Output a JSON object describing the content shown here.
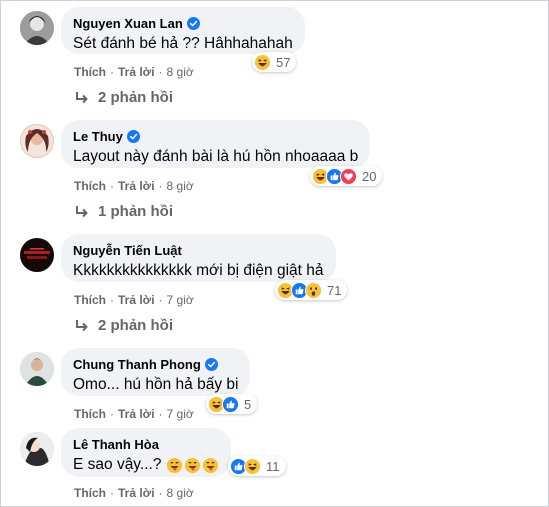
{
  "comments": [
    {
      "name": "Nguyen Xuan Lan",
      "verified": true,
      "text": "Sét đánh bé hả ?? Hâhhahahah",
      "reactions": [
        "haha-icon"
      ],
      "count": "57",
      "like": "Thích",
      "reply": "Trả lời",
      "time": "8 giờ",
      "replies": "2 phản hồi"
    },
    {
      "name": "Le Thuy",
      "verified": true,
      "text": "Layout này đánh bài là hú hồn nhoaaaa b",
      "reactions": [
        "haha-icon",
        "like-icon",
        "love-icon"
      ],
      "count": "20",
      "like": "Thích",
      "reply": "Trả lời",
      "time": "8 giờ",
      "replies": "1 phản hồi"
    },
    {
      "name": "Nguyễn Tiến Luật",
      "verified": false,
      "text": "Kkkkkkkkkkkkkkk mới bị điện giật hả",
      "reactions": [
        "haha-icon",
        "like-icon",
        "wow-icon"
      ],
      "count": "71",
      "like": "Thích",
      "reply": "Trả lời",
      "time": "7 giờ",
      "replies": "2 phản hồi"
    },
    {
      "name": "Chung Thanh Phong",
      "verified": true,
      "text": "Omo... hú hồn hả bấy bi",
      "reactions": [
        "haha-icon",
        "like-icon"
      ],
      "count": "5",
      "like": "Thích",
      "reply": "Trả lời",
      "time": "7 giờ",
      "replies": ""
    },
    {
      "name": "Lê Thanh Hòa",
      "verified": false,
      "text": "E sao vậy...?",
      "text_emoji": "😜😜😜",
      "reactions": [
        "like-icon",
        "haha-icon"
      ],
      "count": "11",
      "like": "Thích",
      "reply": "Trả lời",
      "time": "8 giờ",
      "replies": ""
    }
  ],
  "colors": {
    "bubble": "#f0f2f5",
    "verified": "#1877f2",
    "meta": "#65676b",
    "text": "#050505"
  }
}
